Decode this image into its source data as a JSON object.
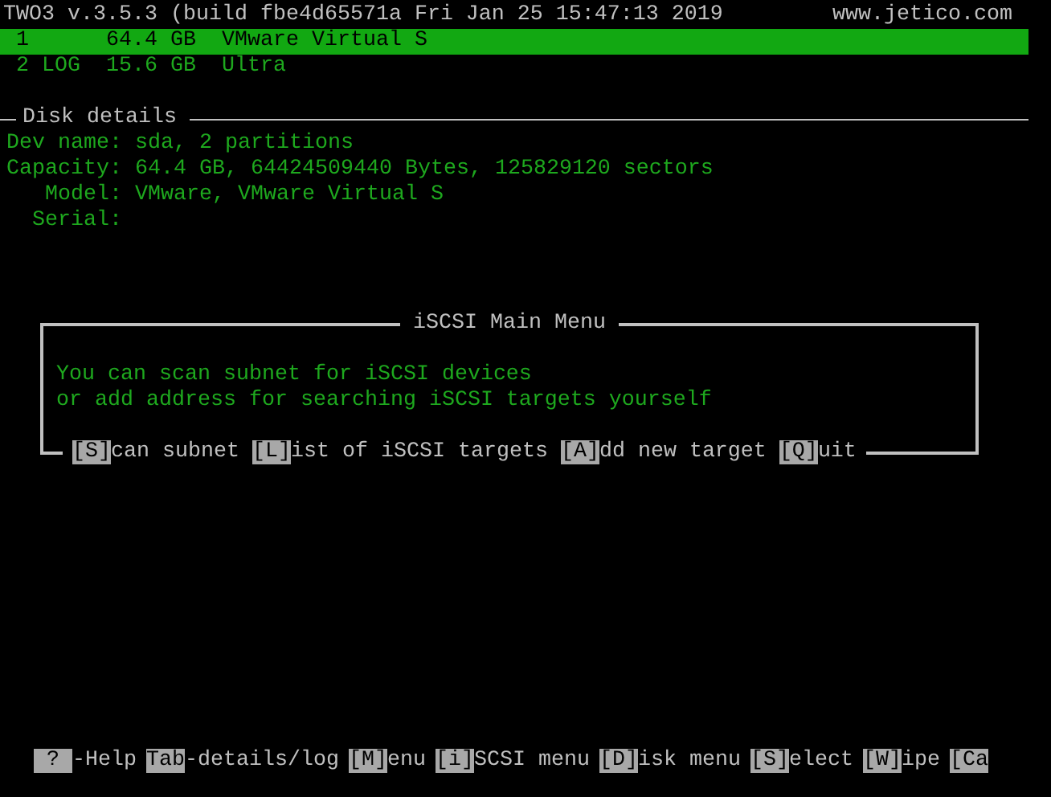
{
  "header": {
    "title": "TWO3 v.3.5.3 (build fbe4d65571a Fri Jan 25 15:47:13 2019",
    "site": "www.jetico.com"
  },
  "disks": [
    {
      "slot": "1",
      "size": "64.4 GB",
      "model": "VMware Virtual S",
      "selected": true
    },
    {
      "slot": "2 LOG",
      "size": "15.6 GB",
      "model": "Ultra",
      "selected": false
    }
  ],
  "disk_details": {
    "title": "Disk details",
    "fields": [
      {
        "label": "Dev name:",
        "value": "sda, 2 partitions"
      },
      {
        "label": "Capacity:",
        "value": "64.4 GB, 64424509440 Bytes, 125829120 sectors"
      },
      {
        "label": "Model:",
        "value": "VMware, VMware Virtual S"
      },
      {
        "label": "Serial:"
      }
    ]
  },
  "dialog": {
    "title": "iSCSI Main Menu",
    "message": [
      "You can scan subnet for iSCSI devices",
      "or add address for searching iSCSI targets yourself"
    ],
    "options": [
      {
        "key": "[S]",
        "label": "can subnet"
      },
      {
        "key": "[L]",
        "label": "ist of iSCSI targets"
      },
      {
        "key": "[A]",
        "label": "dd new target"
      },
      {
        "key": "[Q]",
        "label": "uit"
      }
    ]
  },
  "hotkeys": [
    {
      "key": "?",
      "label": "-Help"
    },
    {
      "key": "Tab",
      "label": "-details/log"
    },
    {
      "key": "[M]",
      "label": "enu"
    },
    {
      "key": "[i]",
      "label": "SCSI menu"
    },
    {
      "key": "[D]",
      "label": "isk menu"
    },
    {
      "key": "[S]",
      "label": "elect"
    },
    {
      "key": "[W]",
      "label": "ipe"
    },
    {
      "key": "[Ca"
    }
  ]
}
